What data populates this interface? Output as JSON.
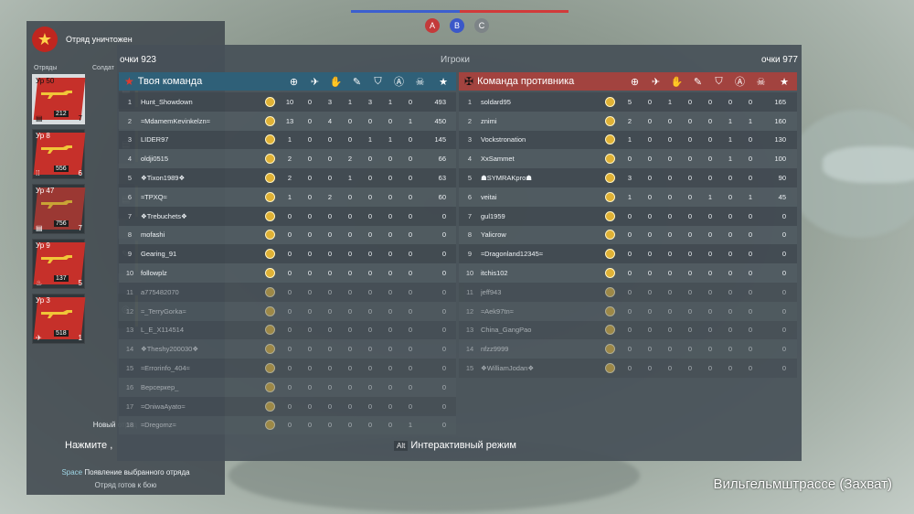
{
  "top_bar": {
    "point_a": "A",
    "point_b": "B",
    "point_c": "C"
  },
  "sidebar": {
    "title": "Отряд уничтожен",
    "col_squads": "Отряды",
    "col_soldiers": "Солдат",
    "squads": [
      {
        "level": "Ур 50",
        "points": "212",
        "count": "7",
        "active": true
      },
      {
        "level": "Ур 8",
        "points": "556",
        "count": "6",
        "active": false
      },
      {
        "level": "Ур 47",
        "points": "756",
        "count": "7",
        "active": false
      },
      {
        "level": "Ур 9",
        "points": "137",
        "count": "5",
        "active": false
      },
      {
        "level": "Ур 3",
        "points": "518",
        "count": "1",
        "active": false
      }
    ],
    "new_squad": "Новый отряд",
    "press": "Нажмите ,",
    "space_key": "Space",
    "space_action": "Появление выбранного отряда",
    "ready": "Отряд готов к бою"
  },
  "scoreboard": {
    "my_score": "очки 923",
    "players_label": "Игроки",
    "enemy_score": "очки 977",
    "my_team": "Твоя команда",
    "enemy_team": "Команда противника",
    "interactive_key": "Alt",
    "interactive_label": "Интерактивный режим",
    "left_rows": [
      {
        "n": "1",
        "name": "Hunt_Showdown",
        "s": [
          "10",
          "0",
          "3",
          "1",
          "3",
          "1",
          "0",
          "493"
        ],
        "dim": false
      },
      {
        "n": "2",
        "name": "≈MdamemKevinkelzn≈",
        "s": [
          "13",
          "0",
          "4",
          "0",
          "0",
          "0",
          "1",
          "450"
        ],
        "dim": false
      },
      {
        "n": "3",
        "name": "LIDER97",
        "s": [
          "1",
          "0",
          "0",
          "0",
          "1",
          "1",
          "0",
          "145"
        ],
        "dim": false
      },
      {
        "n": "4",
        "name": "oldji0515",
        "s": [
          "2",
          "0",
          "0",
          "2",
          "0",
          "0",
          "0",
          "66"
        ],
        "dim": false
      },
      {
        "n": "5",
        "name": "❖Tixon1989❖",
        "s": [
          "2",
          "0",
          "0",
          "1",
          "0",
          "0",
          "0",
          "63"
        ],
        "dim": false
      },
      {
        "n": "6",
        "name": "≈TPXQ≈",
        "s": [
          "1",
          "0",
          "2",
          "0",
          "0",
          "0",
          "0",
          "60"
        ],
        "dim": false
      },
      {
        "n": "7",
        "name": "❖Trebuchets❖",
        "s": [
          "0",
          "0",
          "0",
          "0",
          "0",
          "0",
          "0",
          "0"
        ],
        "dim": false
      },
      {
        "n": "8",
        "name": "mofashi",
        "s": [
          "0",
          "0",
          "0",
          "0",
          "0",
          "0",
          "0",
          "0"
        ],
        "dim": false
      },
      {
        "n": "9",
        "name": "Gearing_91",
        "s": [
          "0",
          "0",
          "0",
          "0",
          "0",
          "0",
          "0",
          "0"
        ],
        "dim": false
      },
      {
        "n": "10",
        "name": "followplz",
        "s": [
          "0",
          "0",
          "0",
          "0",
          "0",
          "0",
          "0",
          "0"
        ],
        "dim": false
      },
      {
        "n": "11",
        "name": "a775482070",
        "s": [
          "0",
          "0",
          "0",
          "0",
          "0",
          "0",
          "0",
          "0"
        ],
        "dim": true
      },
      {
        "n": "12",
        "name": "≈_TerryGorka≈",
        "s": [
          "0",
          "0",
          "0",
          "0",
          "0",
          "0",
          "0",
          "0"
        ],
        "dim": true
      },
      {
        "n": "13",
        "name": "L_E_X114514",
        "s": [
          "0",
          "0",
          "0",
          "0",
          "0",
          "0",
          "0",
          "0"
        ],
        "dim": true
      },
      {
        "n": "14",
        "name": "❖Theshy200030❖",
        "s": [
          "0",
          "0",
          "0",
          "0",
          "0",
          "0",
          "0",
          "0"
        ],
        "dim": true
      },
      {
        "n": "15",
        "name": "≈Errorinfo_404≈",
        "s": [
          "0",
          "0",
          "0",
          "0",
          "0",
          "0",
          "0",
          "0"
        ],
        "dim": true
      },
      {
        "n": "16",
        "name": "Версеркер_",
        "s": [
          "0",
          "0",
          "0",
          "0",
          "0",
          "0",
          "0",
          "0"
        ],
        "dim": true
      },
      {
        "n": "17",
        "name": "≈OniwaAyato≈",
        "s": [
          "0",
          "0",
          "0",
          "0",
          "0",
          "0",
          "0",
          "0"
        ],
        "dim": true
      },
      {
        "n": "18",
        "name": "≈Dregomz≈",
        "s": [
          "0",
          "0",
          "0",
          "0",
          "0",
          "0",
          "1",
          "0"
        ],
        "dim": true
      }
    ],
    "right_rows": [
      {
        "n": "1",
        "name": "soldard95",
        "s": [
          "5",
          "0",
          "1",
          "0",
          "0",
          "0",
          "0",
          "165"
        ],
        "dim": false
      },
      {
        "n": "2",
        "name": "znimi",
        "s": [
          "2",
          "0",
          "0",
          "0",
          "0",
          "1",
          "1",
          "160"
        ],
        "dim": false
      },
      {
        "n": "3",
        "name": "Vockstronation",
        "s": [
          "1",
          "0",
          "0",
          "0",
          "0",
          "1",
          "0",
          "130"
        ],
        "dim": false
      },
      {
        "n": "4",
        "name": "XxSammet",
        "s": [
          "0",
          "0",
          "0",
          "0",
          "0",
          "1",
          "0",
          "100"
        ],
        "dim": false
      },
      {
        "n": "5",
        "name": "☗SYMRAKpro☗",
        "s": [
          "3",
          "0",
          "0",
          "0",
          "0",
          "0",
          "0",
          "90"
        ],
        "dim": false
      },
      {
        "n": "6",
        "name": "veitai",
        "s": [
          "1",
          "0",
          "0",
          "0",
          "1",
          "0",
          "1",
          "45"
        ],
        "dim": false
      },
      {
        "n": "7",
        "name": "gul1959",
        "s": [
          "0",
          "0",
          "0",
          "0",
          "0",
          "0",
          "0",
          "0"
        ],
        "dim": false
      },
      {
        "n": "8",
        "name": "Yalicrow",
        "s": [
          "0",
          "0",
          "0",
          "0",
          "0",
          "0",
          "0",
          "0"
        ],
        "dim": false
      },
      {
        "n": "9",
        "name": "≈Dragonland12345≈",
        "s": [
          "0",
          "0",
          "0",
          "0",
          "0",
          "0",
          "0",
          "0"
        ],
        "dim": false
      },
      {
        "n": "10",
        "name": "itchis102",
        "s": [
          "0",
          "0",
          "0",
          "0",
          "0",
          "0",
          "0",
          "0"
        ],
        "dim": false
      },
      {
        "n": "11",
        "name": "jeff943",
        "s": [
          "0",
          "0",
          "0",
          "0",
          "0",
          "0",
          "0",
          "0"
        ],
        "dim": true
      },
      {
        "n": "12",
        "name": "≈Aek97tn≈",
        "s": [
          "0",
          "0",
          "0",
          "0",
          "0",
          "0",
          "0",
          "0"
        ],
        "dim": true
      },
      {
        "n": "13",
        "name": "China_GangPao",
        "s": [
          "0",
          "0",
          "0",
          "0",
          "0",
          "0",
          "0",
          "0"
        ],
        "dim": true
      },
      {
        "n": "14",
        "name": "nfzz9999",
        "s": [
          "0",
          "0",
          "0",
          "0",
          "0",
          "0",
          "0",
          "0"
        ],
        "dim": true
      },
      {
        "n": "15",
        "name": "❖WilliamJodan❖",
        "s": [
          "0",
          "0",
          "0",
          "0",
          "0",
          "0",
          "0",
          "0"
        ],
        "dim": true
      }
    ],
    "stat_icons": [
      "crosshair-icon",
      "plane-icon",
      "hand-icon",
      "wrench-icon",
      "shield-a-icon",
      "capture-a-icon",
      "skull-icon",
      "star-icon"
    ]
  },
  "location": "Вильгельмштрассе (Захват)",
  "colors": {
    "team_blue": "#2f6078",
    "team_red": "#a2433f",
    "rank_gold": "#e0b236"
  }
}
